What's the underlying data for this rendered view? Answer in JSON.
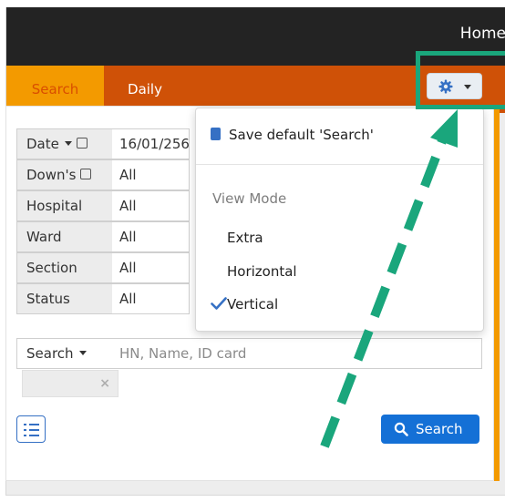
{
  "topbar": {
    "home_label": "Home"
  },
  "tabs": [
    {
      "label": "Search"
    },
    {
      "label": "Daily"
    }
  ],
  "settings_button": {
    "icon": "gear-icon",
    "caret": "caret-down-icon"
  },
  "filters": [
    {
      "label": "Date",
      "value": "16/01/256",
      "has_dropdown": true,
      "has_checkbox": true
    },
    {
      "label": "Down's",
      "value": "All",
      "has_checkbox": true
    },
    {
      "label": "Hospital",
      "value": "All"
    },
    {
      "label": "Ward",
      "value": "All"
    },
    {
      "label": "Section",
      "value": "All"
    },
    {
      "label": "Status",
      "value": "All"
    }
  ],
  "search_field": {
    "label": "Search",
    "placeholder": "HN, Name, ID card"
  },
  "clear_icon": "×",
  "buttons": {
    "list_icon": "list-icon",
    "search_label": "Search"
  },
  "dropdown_menu": {
    "save_default": "Save default 'Search'",
    "view_mode_header": "View Mode",
    "options": [
      "Extra",
      "Horizontal",
      "Vertical"
    ],
    "selected": "Vertical"
  },
  "colors": {
    "topbar": "#232323",
    "tabbar": "#cf5107",
    "active_tab": "#f39a00",
    "primary_button": "#1470d6",
    "annotation": "#1aa67c"
  }
}
